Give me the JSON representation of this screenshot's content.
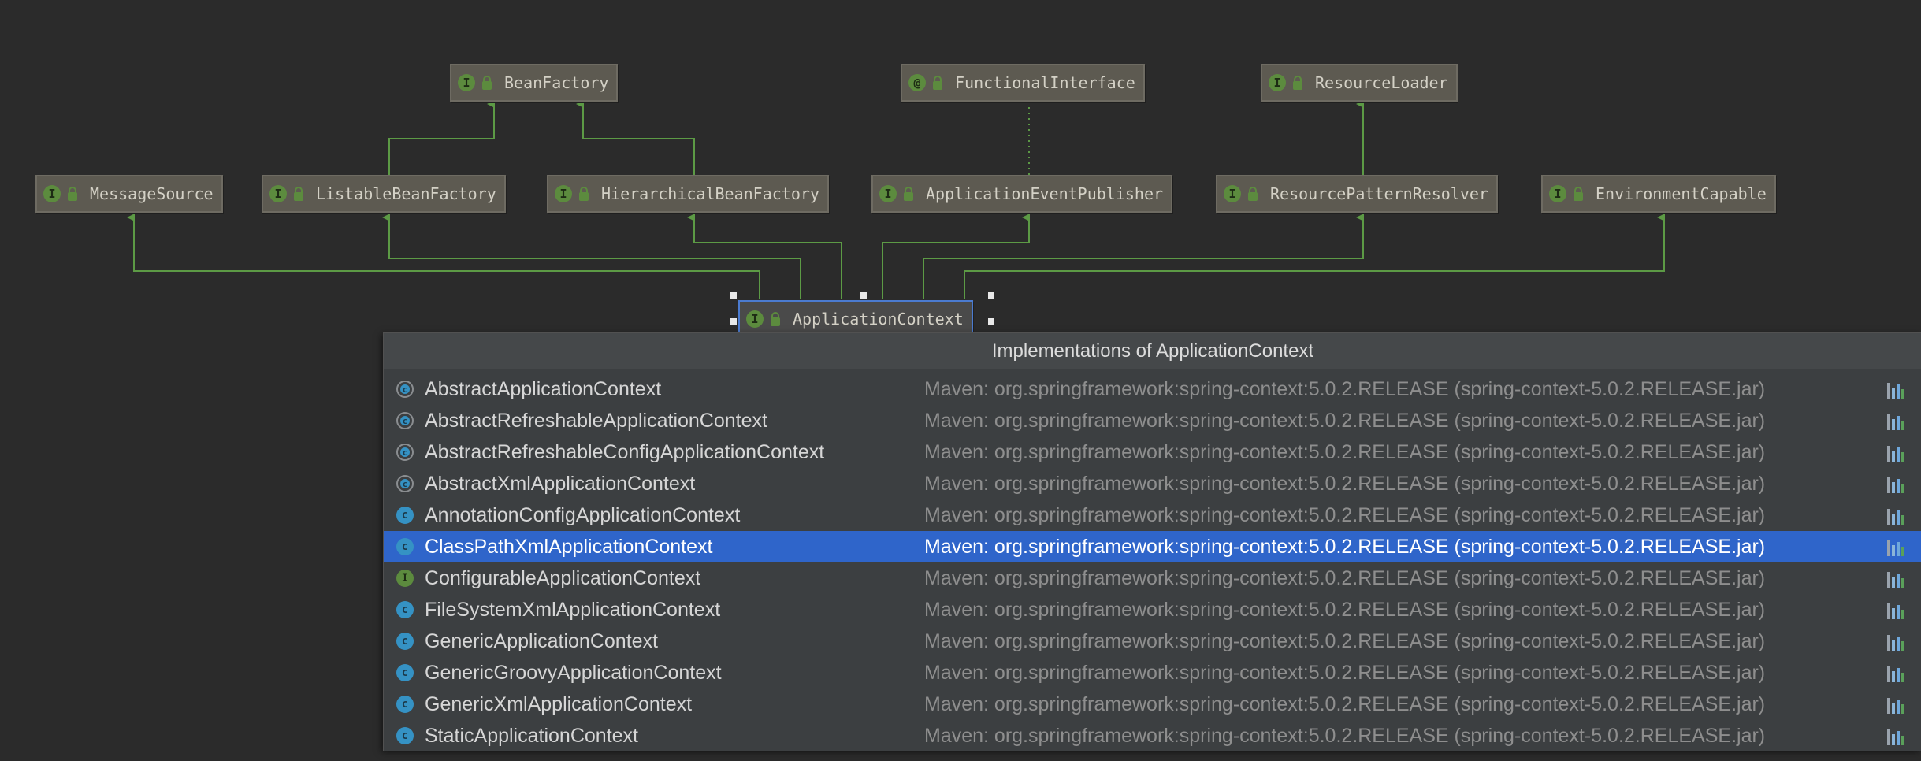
{
  "diagram": {
    "nodes": {
      "bean_factory": {
        "badge": "I",
        "label": "BeanFactory"
      },
      "functional_interface": {
        "badge": "@",
        "label": "FunctionalInterface"
      },
      "resource_loader": {
        "badge": "I",
        "label": "ResourceLoader"
      },
      "message_source": {
        "badge": "I",
        "label": "MessageSource"
      },
      "listable_bean_factory": {
        "badge": "I",
        "label": "ListableBeanFactory"
      },
      "hierarchical_bean_factory": {
        "badge": "I",
        "label": "HierarchicalBeanFactory"
      },
      "application_event_publisher": {
        "badge": "I",
        "label": "ApplicationEventPublisher"
      },
      "resource_pattern_resolver": {
        "badge": "I",
        "label": "ResourcePatternResolver"
      },
      "environment_capable": {
        "badge": "I",
        "label": "EnvironmentCapable"
      },
      "application_context": {
        "badge": "I",
        "label": "ApplicationContext"
      }
    },
    "edge_color": "#5c9a45"
  },
  "popup": {
    "title": "Implementations of ApplicationContext",
    "selected_index": 5,
    "rows": [
      {
        "icon": "abstract-class-icon",
        "kind": "abstract",
        "name": "AbstractApplicationContext",
        "source": "Maven: org.springframework:spring-context:5.0.2.RELEASE (spring-context-5.0.2.RELEASE.jar)"
      },
      {
        "icon": "abstract-class-icon",
        "kind": "abstract",
        "name": "AbstractRefreshableApplicationContext",
        "source": "Maven: org.springframework:spring-context:5.0.2.RELEASE (spring-context-5.0.2.RELEASE.jar)"
      },
      {
        "icon": "abstract-class-icon",
        "kind": "abstract",
        "name": "AbstractRefreshableConfigApplicationContext",
        "source": "Maven: org.springframework:spring-context:5.0.2.RELEASE (spring-context-5.0.2.RELEASE.jar)"
      },
      {
        "icon": "abstract-class-icon",
        "kind": "abstract",
        "name": "AbstractXmlApplicationContext",
        "source": "Maven: org.springframework:spring-context:5.0.2.RELEASE (spring-context-5.0.2.RELEASE.jar)"
      },
      {
        "icon": "class-icon",
        "kind": "class",
        "name": "AnnotationConfigApplicationContext",
        "source": "Maven: org.springframework:spring-context:5.0.2.RELEASE (spring-context-5.0.2.RELEASE.jar)"
      },
      {
        "icon": "class-icon",
        "kind": "class",
        "name": "ClassPathXmlApplicationContext",
        "source": "Maven: org.springframework:spring-context:5.0.2.RELEASE (spring-context-5.0.2.RELEASE.jar)"
      },
      {
        "icon": "interface-icon",
        "kind": "interface",
        "name": "ConfigurableApplicationContext",
        "source": "Maven: org.springframework:spring-context:5.0.2.RELEASE (spring-context-5.0.2.RELEASE.jar)"
      },
      {
        "icon": "class-icon",
        "kind": "class",
        "name": "FileSystemXmlApplicationContext",
        "source": "Maven: org.springframework:spring-context:5.0.2.RELEASE (spring-context-5.0.2.RELEASE.jar)"
      },
      {
        "icon": "class-icon",
        "kind": "class",
        "name": "GenericApplicationContext",
        "source": "Maven: org.springframework:spring-context:5.0.2.RELEASE (spring-context-5.0.2.RELEASE.jar)"
      },
      {
        "icon": "class-icon",
        "kind": "class",
        "name": "GenericGroovyApplicationContext",
        "source": "Maven: org.springframework:spring-context:5.0.2.RELEASE (spring-context-5.0.2.RELEASE.jar)"
      },
      {
        "icon": "class-icon",
        "kind": "class",
        "name": "GenericXmlApplicationContext",
        "source": "Maven: org.springframework:spring-context:5.0.2.RELEASE (spring-context-5.0.2.RELEASE.jar)"
      },
      {
        "icon": "class-icon",
        "kind": "class",
        "name": "StaticApplicationContext",
        "source": "Maven: org.springframework:spring-context:5.0.2.RELEASE (spring-context-5.0.2.RELEASE.jar)"
      }
    ],
    "colors": {
      "selection": "#2f65ca",
      "class_icon": "#3592c4",
      "interface_icon": "#5c8b3e"
    }
  }
}
